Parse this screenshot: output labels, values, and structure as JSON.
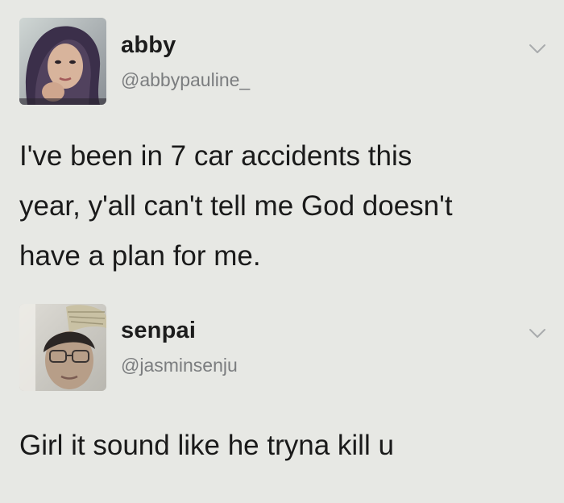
{
  "tweets": [
    {
      "display_name": "abby",
      "handle": "@abbypauline_",
      "text": "I've been in 7 car accidents this\nyear, y'all can't tell me God doesn't\nhave a plan for me.",
      "avatar_icon": "profile-photo-icon",
      "menu_icon": "chevron-down-icon"
    },
    {
      "display_name": "senpai",
      "handle": "@jasminsenju",
      "text": "Girl it sound like he tryna kill u",
      "avatar_icon": "profile-photo-icon",
      "menu_icon": "chevron-down-icon"
    }
  ],
  "colors": {
    "background": "#e7e8e4",
    "name": "#1c1c1c",
    "handle": "#7b7d7f",
    "text": "#1a1a1a",
    "chevron": "#a9abad"
  }
}
